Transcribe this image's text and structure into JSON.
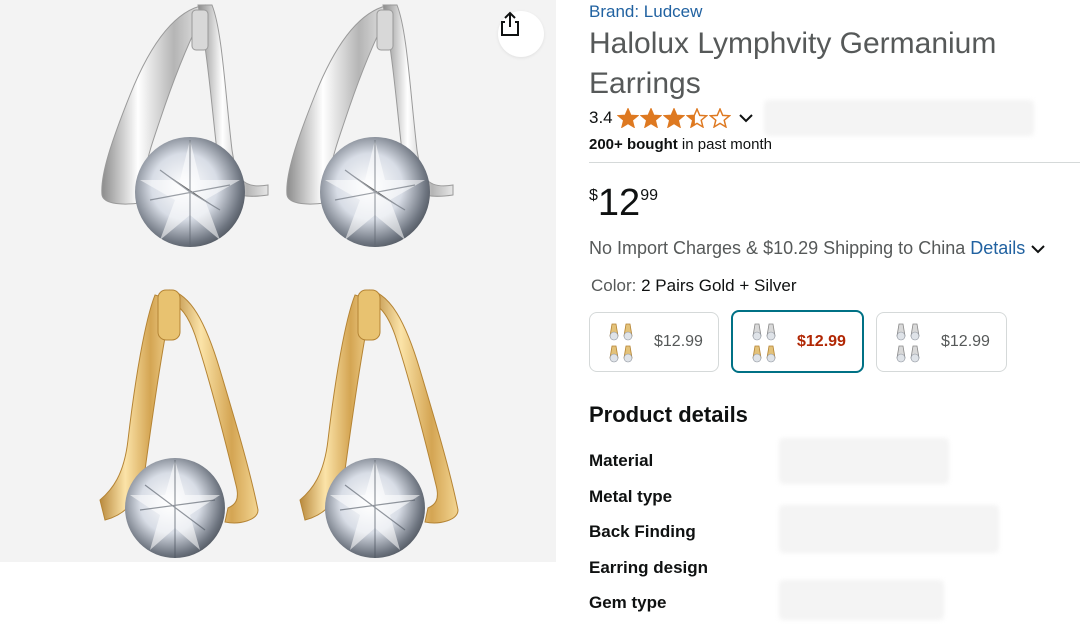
{
  "product": {
    "brand_label": "Brand: Ludcew",
    "title": "Halolux Lymphvity Germanium Earrings",
    "rating": "3.4",
    "rating_value": 3.4,
    "rating_max": 5,
    "bought_bold": "200+ bought",
    "bought_rest": " in past month",
    "price_symbol": "$",
    "price_whole": "12",
    "price_fraction": "99",
    "shipping_text": "No Import Charges & $10.29 Shipping to China",
    "shipping_link": "Details",
    "color_label": "Color:",
    "color_value": "2 Pairs Gold + Silver"
  },
  "variants": [
    {
      "price": "$12.99",
      "selected": false
    },
    {
      "price": "$12.99",
      "selected": true
    },
    {
      "price": "$12.99",
      "selected": false
    }
  ],
  "details": {
    "heading": "Product details",
    "rows": [
      "Material",
      "Metal type",
      "Back Finding",
      "Earring design",
      "Gem type"
    ]
  },
  "icons": {
    "share": "share-icon",
    "chevron": "chevron-down-icon",
    "star": "star-icon"
  },
  "colors": {
    "link": "#2162a1",
    "star": "#de7921",
    "selected_border": "#007185",
    "selected_price": "#b12704"
  }
}
